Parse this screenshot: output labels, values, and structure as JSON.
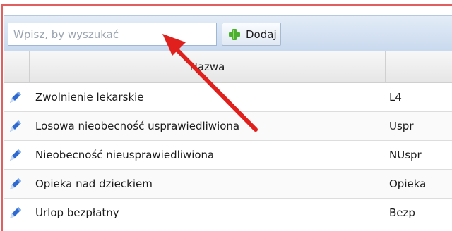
{
  "toolbar": {
    "search_placeholder": "Wpisz, by wyszukać",
    "search_value": "",
    "add_label": "Dodaj"
  },
  "table": {
    "columns": [
      "",
      "Nazwa",
      ""
    ],
    "rows": [
      {
        "name": "Zwolnienie lekarskie",
        "code": "L4"
      },
      {
        "name": "Losowa nieobecność usprawiedliwiona",
        "code": "Uspr"
      },
      {
        "name": "Nieobecność nieusprawiedliwiona",
        "code": "NUspr"
      },
      {
        "name": "Opieka nad dzieckiem",
        "code": "Opieka"
      },
      {
        "name": "Urlop bezpłatny",
        "code": "Bezp"
      }
    ]
  },
  "colors": {
    "accent_arrow": "#e0201c",
    "add_icon": "#4caf30",
    "edit_icon": "#2f6ad0"
  }
}
